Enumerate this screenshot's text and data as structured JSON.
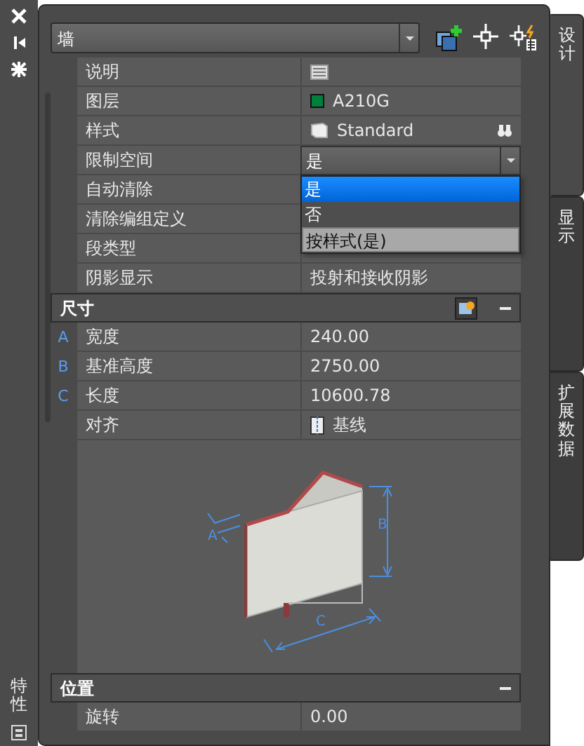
{
  "palette_title": "特性",
  "object_type": {
    "value": "墙"
  },
  "tabs": [
    {
      "label": "设计",
      "selected": true
    },
    {
      "label": "显示",
      "selected": false
    },
    {
      "label": "扩展数据",
      "selected": false
    }
  ],
  "sections": [
    {
      "rows": [
        {
          "name": "说明",
          "kind": "description"
        },
        {
          "name": "图层",
          "kind": "layer",
          "value": "A210G",
          "color": "#00803c"
        },
        {
          "name": "样式",
          "kind": "style",
          "value": "Standard"
        },
        {
          "name": "限制空间",
          "kind": "dropdown",
          "value": "是",
          "options": [
            {
              "label": "是",
              "selected": true,
              "hovered": false
            },
            {
              "label": "否",
              "selected": false,
              "hovered": false
            },
            {
              "label": "按样式(是)",
              "selected": false,
              "hovered": true
            }
          ]
        },
        {
          "name": "自动清除",
          "kind": "text"
        },
        {
          "name": "清除编组定义",
          "kind": "text"
        },
        {
          "name": "段类型",
          "kind": "text"
        },
        {
          "name": "阴影显示",
          "kind": "text",
          "value": "投射和接收阴影"
        }
      ]
    },
    {
      "title": "尺寸",
      "expanded": true,
      "has_tool": true,
      "rows": [
        {
          "marker": "A",
          "name": "宽度",
          "kind": "text",
          "value": "240.00"
        },
        {
          "marker": "B",
          "name": "基准高度",
          "kind": "text",
          "value": "2750.00"
        },
        {
          "marker": "C",
          "name": "长度",
          "kind": "text",
          "value": "10600.78"
        },
        {
          "name": "对齐",
          "kind": "alignment",
          "value": "基线"
        },
        {
          "kind": "diagram",
          "labels": [
            "A",
            "B",
            "C"
          ]
        }
      ]
    },
    {
      "title": "位置",
      "expanded": true,
      "rows": [
        {
          "name": "旋转",
          "kind": "text",
          "value": "0.00"
        }
      ]
    }
  ]
}
